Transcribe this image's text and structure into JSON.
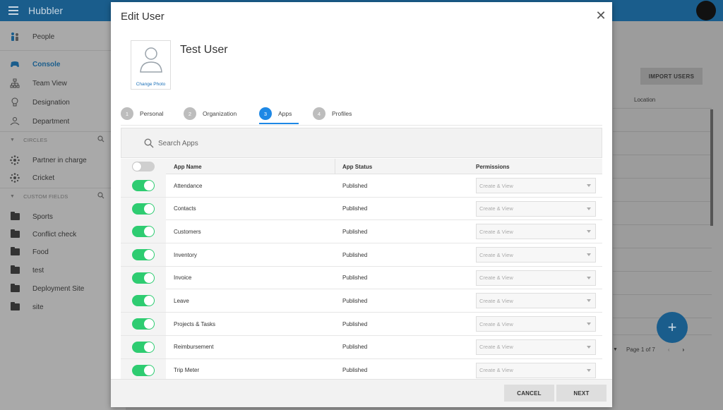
{
  "app": {
    "brand": "Hubbler"
  },
  "sidebar": {
    "people_label": "People",
    "items": [
      {
        "label": "Console",
        "icon": "gamepad-icon"
      },
      {
        "label": "Team View",
        "icon": "org-chart-icon"
      },
      {
        "label": "Designation",
        "icon": "lightbulb-icon"
      },
      {
        "label": "Department",
        "icon": "department-icon"
      }
    ],
    "circles_label": "CIRCLES",
    "circles": [
      {
        "label": "Partner in charge"
      },
      {
        "label": "Cricket"
      }
    ],
    "custom_fields_label": "CUSTOM FIELDS",
    "custom_fields": [
      {
        "label": "Sports"
      },
      {
        "label": "Conflict check"
      },
      {
        "label": "Food"
      },
      {
        "label": "test"
      },
      {
        "label": "Deployment Site"
      },
      {
        "label": "site"
      }
    ]
  },
  "background": {
    "import_users_label": "IMPORT USERS",
    "location_header": "Location",
    "pager_label": "Page 1 of 7",
    "fab_label": "+"
  },
  "modal": {
    "title": "Edit User",
    "change_photo_label": "Change Photo",
    "user_name": "Test User",
    "steps": [
      {
        "num": "1",
        "label": "Personal"
      },
      {
        "num": "2",
        "label": "Organization"
      },
      {
        "num": "3",
        "label": "Apps"
      },
      {
        "num": "4",
        "label": "Profiles"
      }
    ],
    "active_step": "Apps",
    "search_placeholder": "Search Apps",
    "columns": {
      "app_name": "App Name",
      "app_status": "App Status",
      "permissions": "Permissions"
    },
    "rows": [
      {
        "name": "Attendance",
        "status": "Published",
        "permission": "Create & View",
        "enabled": true
      },
      {
        "name": "Contacts",
        "status": "Published",
        "permission": "Create & View",
        "enabled": true
      },
      {
        "name": "Customers",
        "status": "Published",
        "permission": "Create & View",
        "enabled": true
      },
      {
        "name": "Inventory",
        "status": "Published",
        "permission": "Create & View",
        "enabled": true
      },
      {
        "name": "Invoice",
        "status": "Published",
        "permission": "Create & View",
        "enabled": true
      },
      {
        "name": "Leave",
        "status": "Published",
        "permission": "Create & View",
        "enabled": true
      },
      {
        "name": "Projects & Tasks",
        "status": "Published",
        "permission": "Create & View",
        "enabled": true
      },
      {
        "name": "Reimbursement",
        "status": "Published",
        "permission": "Create & View",
        "enabled": true
      },
      {
        "name": "Trip Meter",
        "status": "Published",
        "permission": "Create & View",
        "enabled": true
      }
    ],
    "cancel_label": "CANCEL",
    "next_label": "NEXT"
  },
  "colors": {
    "brand_blue": "#1a5d8c",
    "active_step": "#1e88e5",
    "toggle_on": "#2ecc71"
  }
}
